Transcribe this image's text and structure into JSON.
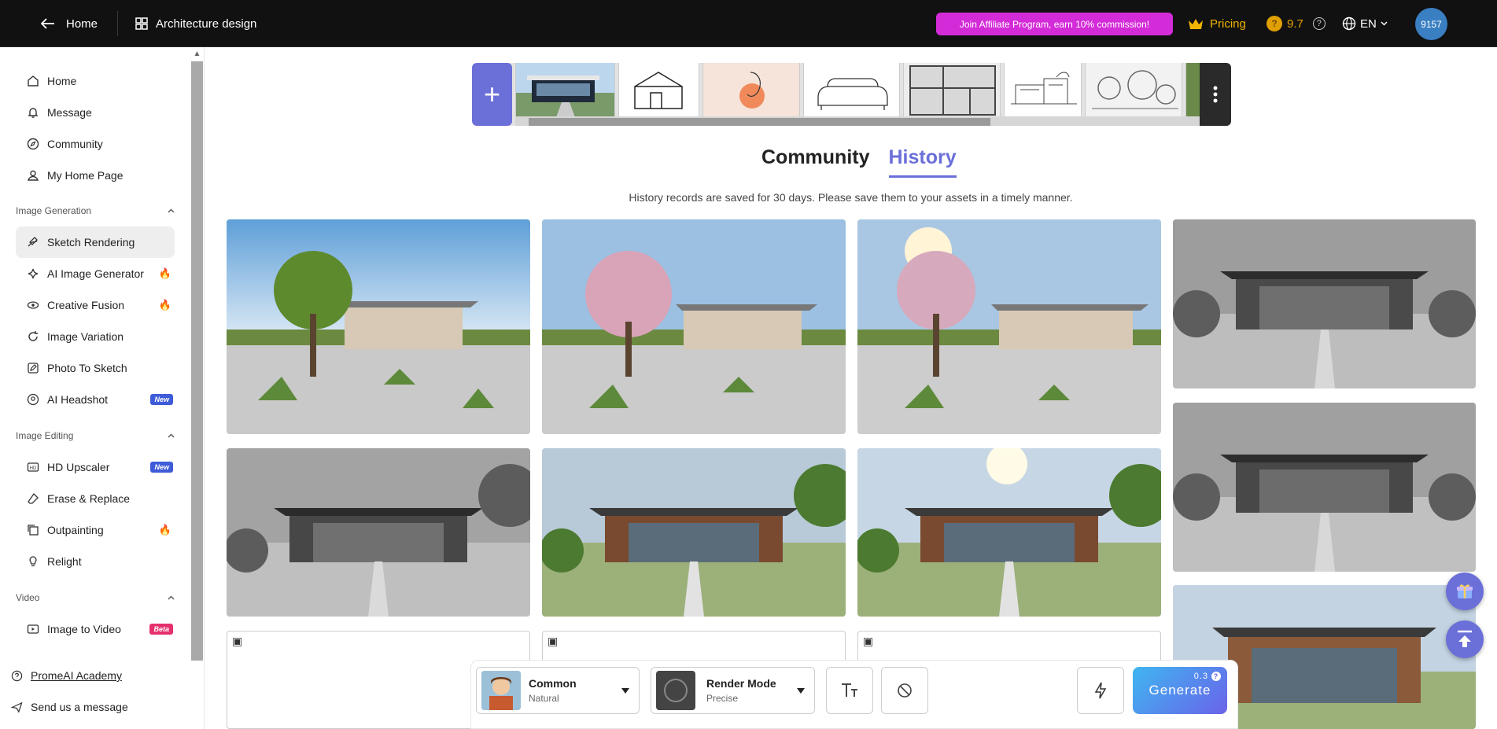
{
  "topbar": {
    "home_label": "Home",
    "project_label": "Architecture design",
    "affiliate_label": "Join Affiliate Program, earn 10% commission!",
    "pricing_label": "Pricing",
    "credits": "9.7",
    "language": "EN",
    "avatar_label": "9157"
  },
  "sidebar": {
    "main_items": [
      {
        "label": "Home",
        "icon": "home-icon"
      },
      {
        "label": "Message",
        "icon": "bell-icon"
      },
      {
        "label": "Community",
        "icon": "compass-icon"
      },
      {
        "label": "My Home Page",
        "icon": "user-icon"
      }
    ],
    "sections": {
      "image_generation": "Image Generation",
      "image_editing": "Image Editing",
      "video": "Video"
    },
    "generation_items": [
      {
        "label": "Sketch Rendering",
        "icon": "sketch-icon"
      },
      {
        "label": "AI Image Generator",
        "icon": "sparkle-icon"
      },
      {
        "label": "Creative Fusion",
        "icon": "fusion-icon"
      },
      {
        "label": "Image Variation",
        "icon": "refresh-icon"
      },
      {
        "label": "Photo To Sketch",
        "icon": "edit-icon"
      },
      {
        "label": "AI Headshot",
        "icon": "headshot-icon"
      }
    ],
    "editing_items": [
      {
        "label": "HD Upscaler",
        "icon": "hd-icon"
      },
      {
        "label": "Erase & Replace",
        "icon": "eraser-icon"
      },
      {
        "label": "Outpainting",
        "icon": "outpaint-icon"
      },
      {
        "label": "Relight",
        "icon": "bulb-icon"
      }
    ],
    "video_items": [
      {
        "label": "Image to Video",
        "icon": "video-icon"
      }
    ],
    "badge_new": "New",
    "badge_beta": "Beta",
    "footer_academy": "PromeAI Academy",
    "footer_message": "Send us a message"
  },
  "tabs": {
    "community": "Community",
    "history": "History"
  },
  "notice": "History records are saved for 30 days. Please save them to your assets in a timely manner.",
  "bottom_bar": {
    "style_label": "Common",
    "style_sub": "Natural",
    "mode_label": "Render Mode",
    "mode_sub": "Precise",
    "generate_label": "Generate",
    "generate_cost": "0.3"
  },
  "colors": {
    "accent": "#6b6fd8",
    "affiliate": "#d42bd8",
    "pricing": "#f0b400",
    "fire": "#e8570c"
  }
}
